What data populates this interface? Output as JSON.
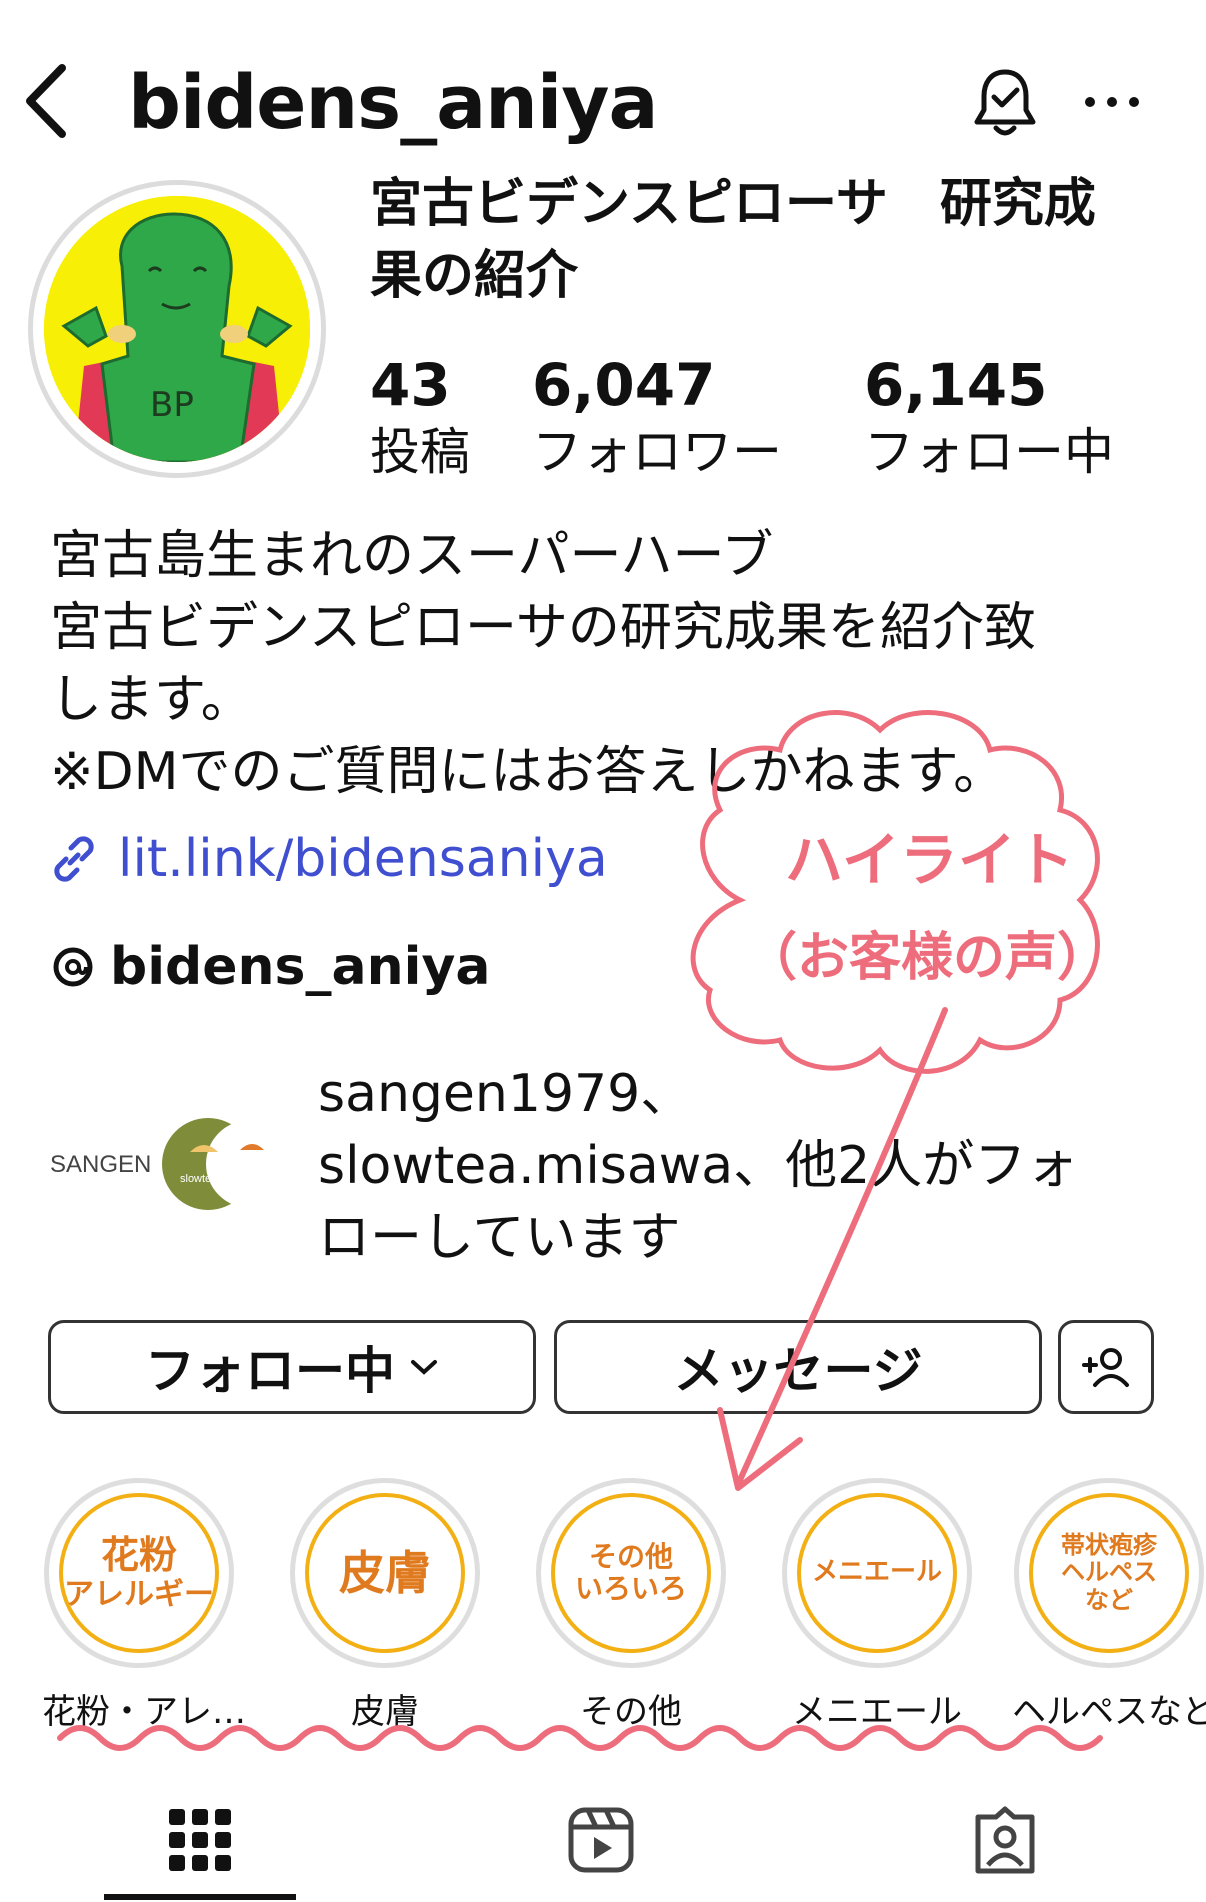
{
  "header": {
    "username": "bidens_aniya",
    "back_icon": "chevron-left-icon",
    "bell_icon": "notification-bell-icon",
    "more_icon": "more-dots-icon"
  },
  "profile": {
    "display_name_line1": "宮古ビデンスピローサ　研究成",
    "display_name_line2": "果の紹介",
    "avatar_text": "BP",
    "stats": [
      {
        "value": "43",
        "label": "投稿"
      },
      {
        "value": "6,047",
        "label": "フォロワー"
      },
      {
        "value": "6,145",
        "label": "フォロー中"
      }
    ]
  },
  "bio": {
    "lines": [
      "宮古島生まれのスーパーハーブ",
      "宮古ビデンスピローサの研究成果を紹介致",
      "します。",
      "※DMでのご質問にはお答えしかねます。"
    ],
    "link": "lit.link/bidensaniya",
    "threads": "bidens_aniya"
  },
  "mutual": {
    "logo1": "SANGEN",
    "logo2": "slowtea・ratte",
    "text_line1": "sangen1979、",
    "text_line2": "slowtea.misawa、他2人がフォ",
    "text_line3": "ローしています"
  },
  "buttons": {
    "follow": "フォロー中",
    "message": "メッセージ",
    "add_person_icon": "add-person-icon"
  },
  "highlights": [
    {
      "cover_line1": "花粉",
      "cover_line2": "アレルギー",
      "label": "花粉・アレ…"
    },
    {
      "cover_line1": "皮膚",
      "cover_line2": "",
      "label": "皮膚"
    },
    {
      "cover_line1": "その他",
      "cover_line2": "いろいろ",
      "label": "その他"
    },
    {
      "cover_line1": "メニエール",
      "cover_line2": "",
      "label": "メニエール"
    },
    {
      "cover_line1": "帯状疱疹",
      "cover_line2": "ヘルペス",
      "cover_line3": "など",
      "label": "ヘルペスなど"
    }
  ],
  "annotation": {
    "line1": "ハイライト",
    "line2": "（お客様の声）",
    "color": "#ee6d7c"
  },
  "tabs": {
    "grid_icon": "grid-icon",
    "reels_icon": "reels-icon",
    "tagged_icon": "tagged-icon"
  },
  "colors": {
    "link": "#3f4fd0",
    "highlight_ring": "#f3b015",
    "highlight_text": "#e07a1f",
    "avatar_bg": "#f7ef05",
    "avatar_figure": "#2fa84a"
  }
}
